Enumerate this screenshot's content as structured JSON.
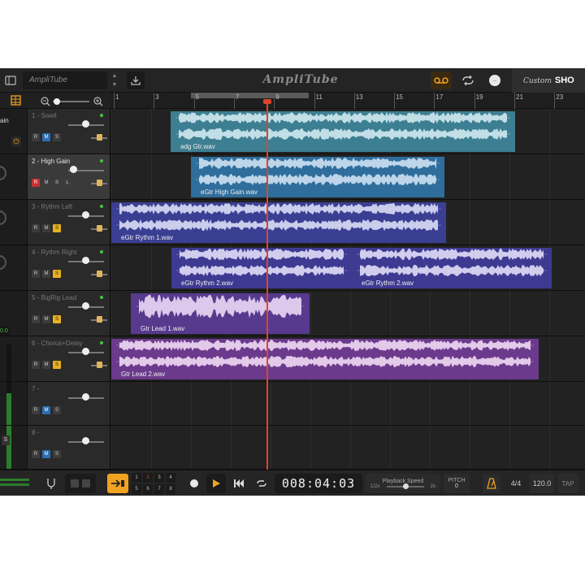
{
  "app": {
    "logo": "AmpliTube",
    "preset_name": "AmpliTube",
    "custom_shop_script": "Custom",
    "custom_shop_bold": "SHO"
  },
  "ruler": {
    "numbers": [
      "1",
      "3",
      "5",
      "7",
      "9",
      "11",
      "13",
      "15",
      "17",
      "19",
      "21",
      "23"
    ]
  },
  "zoom": {
    "minus": "−",
    "plus": "+"
  },
  "tracks": [
    {
      "name": "1 - Swell",
      "rec": false,
      "mute": true,
      "solo": false,
      "selected": false,
      "clips": [
        {
          "label": "adg Gtr.wav",
          "color": "#3d7f92"
        }
      ]
    },
    {
      "name": "2 - High Gain",
      "rec": true,
      "mute": false,
      "solo": false,
      "selected": true,
      "clips": [
        {
          "label": "eGtr High Gain.wav",
          "color": "#2f6e9c"
        }
      ]
    },
    {
      "name": "3 - Rythm Left",
      "rec": false,
      "mute": false,
      "solo": true,
      "selected": false,
      "clips": [
        {
          "label": "eGtr Rythm 1.wav",
          "color": "#3b3f93"
        }
      ]
    },
    {
      "name": "4 - Rythm Right",
      "rec": false,
      "mute": false,
      "solo": true,
      "selected": false,
      "clips": [
        {
          "label": "eGtr Rythm 2.wav",
          "color": "#3e3a92"
        },
        {
          "label": "eGtr Rythm 2.wav",
          "color": "#3e3a92"
        }
      ]
    },
    {
      "name": "5 - BigRig Lead",
      "rec": false,
      "mute": false,
      "solo": true,
      "selected": false,
      "clips": [
        {
          "label": "Gtr Lead 1.wav",
          "color": "#573a8d"
        }
      ]
    },
    {
      "name": "6 - Chorus+Delay",
      "rec": false,
      "mute": false,
      "solo": true,
      "selected": false,
      "clips": [
        {
          "label": "Gtr Lead 2.wav",
          "color": "#6b3a8c"
        }
      ]
    },
    {
      "name": "7 -",
      "rec": false,
      "mute": true,
      "solo": false,
      "selected": false,
      "clips": []
    },
    {
      "name": "8 -",
      "rec": false,
      "mute": true,
      "solo": false,
      "selected": false,
      "clips": []
    }
  ],
  "track_buttons": {
    "rec": "R",
    "mute": "M",
    "solo": "S",
    "link": "L"
  },
  "left_strip": {
    "top_text": "ain",
    "level": "0.0",
    "solo": "S"
  },
  "transport": {
    "counter": "008:04:03",
    "playback_speed_label": "Playback Speed",
    "speed_min": "1/2x",
    "speed_max": "2x",
    "pitch_label": "PITCH",
    "pitch_value": "0",
    "time_signature": "4/4",
    "tempo": "120.0",
    "tap": "TAP",
    "track_select": [
      "1",
      "2",
      "3",
      "4",
      "5",
      "6",
      "7",
      "8"
    ],
    "active_track_select": "2"
  },
  "colors": {
    "accent_orange": "#f0a320",
    "playhead": "#d9472c",
    "led_green": "#47c43f"
  }
}
